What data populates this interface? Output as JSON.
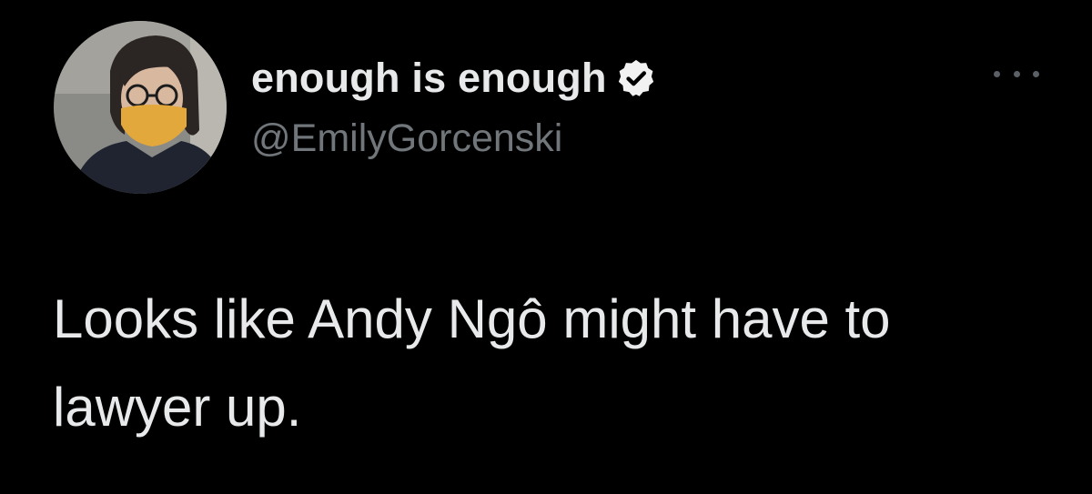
{
  "author": {
    "display_name": "enough is enough",
    "handle": "@EmilyGorcenski",
    "verified": true,
    "avatar": "profile-photo"
  },
  "tweet": {
    "text": "Looks like Andy Ngô might have to lawyer up."
  },
  "icons": {
    "verified": "verified-badge-icon",
    "more": "more-options-icon"
  },
  "colors": {
    "background": "#000000",
    "primary_text": "#e7e9ea",
    "secondary_text": "#71767b",
    "badge_fill": "#f2f2f2"
  }
}
